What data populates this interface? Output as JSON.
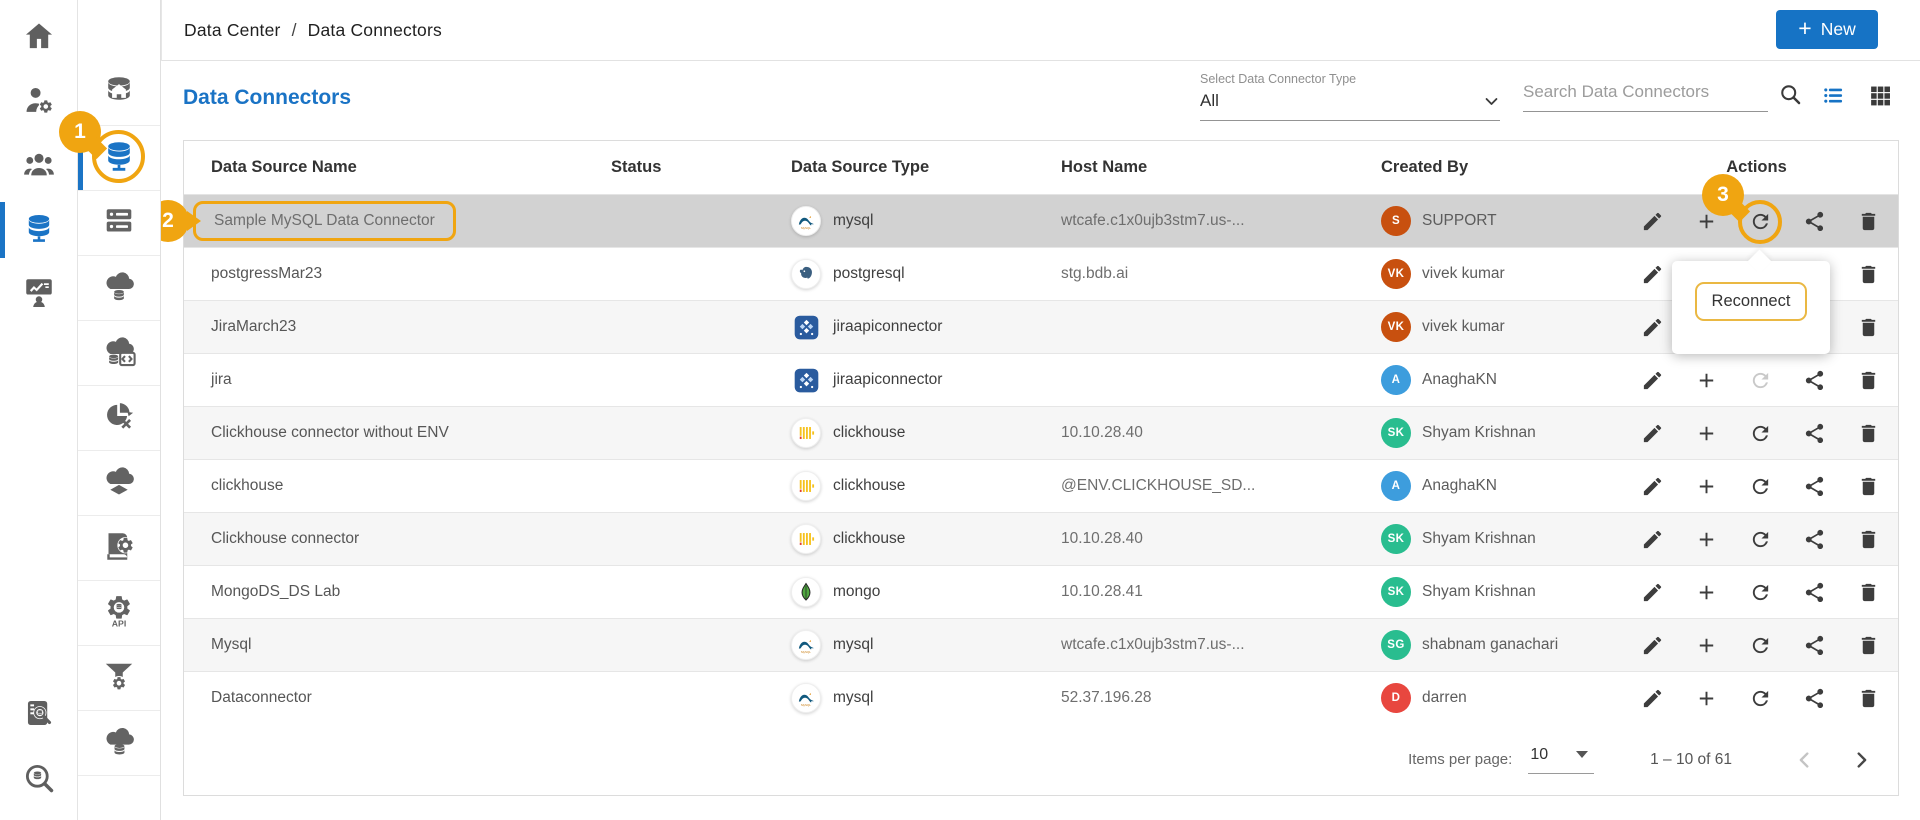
{
  "topbar": {
    "menu_icon": "hamburger-icon",
    "breadcrumb": {
      "section": "Data Center",
      "separator": "/",
      "page": "Data Connectors"
    },
    "new_button": {
      "label": "New",
      "icon": "plus-icon"
    }
  },
  "primary_sidebar": {
    "items": [
      {
        "icon": "home"
      },
      {
        "icon": "user-settings"
      },
      {
        "icon": "user-group"
      },
      {
        "icon": "database-network",
        "active": true
      },
      {
        "icon": "kpi-board"
      }
    ],
    "bottom_items": [
      {
        "icon": "audit-book"
      },
      {
        "icon": "search-database"
      }
    ]
  },
  "secondary_sidebar": {
    "items": [
      {
        "icon": "data-home"
      },
      {
        "icon": "data-connectors",
        "active": true
      },
      {
        "icon": "server-rack"
      },
      {
        "icon": "cloud-database"
      },
      {
        "icon": "data-sets"
      },
      {
        "icon": "data-preparation"
      },
      {
        "icon": "data-lake"
      },
      {
        "icon": "data-store"
      },
      {
        "icon": "api-connectors"
      },
      {
        "icon": "data-pipeline"
      },
      {
        "icon": "data-sheets"
      }
    ]
  },
  "page": {
    "title": "Data Connectors",
    "filter": {
      "label": "Select Data Connector Type",
      "value": "All"
    },
    "search": {
      "placeholder": "Search Data Connectors"
    },
    "view_toggle": {
      "active": "list",
      "icons": [
        "list-view-icon",
        "grid-view-icon"
      ]
    }
  },
  "table": {
    "columns": [
      "Data Source Name",
      "Status",
      "Data Source Type",
      "Host Name",
      "Created By",
      "Actions"
    ],
    "action_icons": [
      "edit",
      "add",
      "reconnect",
      "share",
      "delete"
    ],
    "rows": [
      {
        "name": "Sample MySQL Data Connector",
        "status": "",
        "type": "mysql",
        "host": "wtcafe.c1x0ujb3stm7.us-...",
        "creator": {
          "initials": "S",
          "name": "SUPPORT",
          "color": "#c8500f"
        },
        "selected": true,
        "highlighted": true
      },
      {
        "name": "postgressMar23",
        "status": "",
        "type": "postgresql",
        "host": "stg.bdb.ai",
        "creator": {
          "initials": "VK",
          "name": "vivek kumar",
          "color": "#c8500f"
        }
      },
      {
        "name": "JiraMarch23",
        "status": "",
        "type": "jiraapiconnector",
        "host": "",
        "creator": {
          "initials": "VK",
          "name": "vivek kumar",
          "color": "#c8500f"
        }
      },
      {
        "name": "jira",
        "status": "",
        "type": "jiraapiconnector",
        "host": "",
        "creator": {
          "initials": "A",
          "name": "AnaghaKN",
          "color": "#3d9ddd"
        },
        "reconnect": "disabled"
      },
      {
        "name": "Clickhouse connector without ENV",
        "status": "",
        "type": "clickhouse",
        "host": "10.10.28.40",
        "creator": {
          "initials": "SK",
          "name": "Shyam Krishnan",
          "color": "#29bd8f"
        }
      },
      {
        "name": "clickhouse",
        "status": "",
        "type": "clickhouse",
        "host": "@ENV.CLICKHOUSE_SD...",
        "creator": {
          "initials": "A",
          "name": "AnaghaKN",
          "color": "#3d9ddd"
        }
      },
      {
        "name": "Clickhouse connector",
        "status": "",
        "type": "clickhouse",
        "host": "10.10.28.40",
        "creator": {
          "initials": "SK",
          "name": "Shyam Krishnan",
          "color": "#29bd8f"
        }
      },
      {
        "name": "MongoDS_DS Lab",
        "status": "",
        "type": "mongo",
        "host": "10.10.28.41",
        "creator": {
          "initials": "SK",
          "name": "Shyam Krishnan",
          "color": "#29bd8f"
        }
      },
      {
        "name": "Mysql",
        "status": "",
        "type": "mysql",
        "host": "wtcafe.c1x0ujb3stm7.us-...",
        "creator": {
          "initials": "SG",
          "name": "shabnam ganachari",
          "color": "#29bd8f"
        }
      },
      {
        "name": "Dataconnector",
        "status": "",
        "type": "mysql",
        "host": "52.37.196.28",
        "creator": {
          "initials": "D",
          "name": "darren",
          "color": "#e8473f"
        }
      }
    ]
  },
  "tooltip": {
    "label": "Reconnect"
  },
  "annotations": {
    "step1": "1",
    "step2": "2",
    "step3": "3",
    "accent_color": "#f0a511"
  },
  "pagination": {
    "items_per_page_label": "Items per page:",
    "items_per_page_value": "10",
    "range": "1 – 10 of 61",
    "prev_enabled": false,
    "next_enabled": true
  },
  "colors": {
    "accent_blue": "#1673c5",
    "annotation_orange": "#f0a511",
    "selected_row": "#d2d2d2"
  }
}
